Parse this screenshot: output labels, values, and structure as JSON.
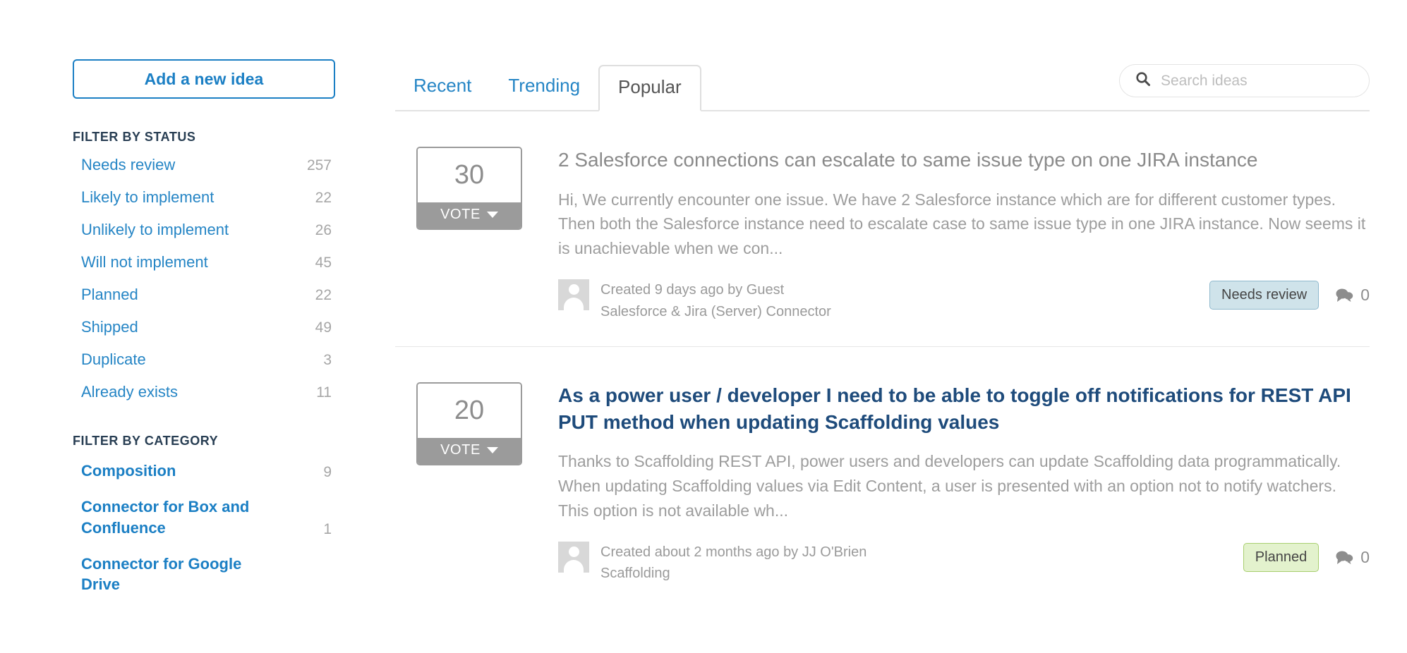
{
  "sidebar": {
    "add_idea_label": "Add a new idea",
    "status_heading": "FILTER BY STATUS",
    "statuses": [
      {
        "label": "Needs review",
        "count": "257"
      },
      {
        "label": "Likely to implement",
        "count": "22"
      },
      {
        "label": "Unlikely to implement",
        "count": "26"
      },
      {
        "label": "Will not implement",
        "count": "45"
      },
      {
        "label": "Planned",
        "count": "22"
      },
      {
        "label": "Shipped",
        "count": "49"
      },
      {
        "label": "Duplicate",
        "count": "3"
      },
      {
        "label": "Already exists",
        "count": "11"
      }
    ],
    "category_heading": "FILTER BY CATEGORY",
    "categories": [
      {
        "label": "Composition",
        "count": "9"
      },
      {
        "label": "Connector for Box and Confluence",
        "count": "1"
      },
      {
        "label": "Connector for Google Drive",
        "count": ""
      }
    ]
  },
  "tabs": [
    {
      "label": "Recent",
      "active": false
    },
    {
      "label": "Trending",
      "active": false
    },
    {
      "label": "Popular",
      "active": true
    }
  ],
  "search": {
    "placeholder": "Search ideas",
    "value": "",
    "icon": "search-icon"
  },
  "ideas": [
    {
      "votes": "30",
      "vote_label": "VOTE",
      "title": "2 Salesforce connections can escalate to same issue type on one JIRA instance",
      "description": "Hi, We currently encounter one issue. We have 2 Salesforce instance which are for different customer types. Then both the Salesforce instance need to escalate case to same issue type in one JIRA instance. Now seems it is unachievable when we con...",
      "created": "Created 9 days ago by Guest",
      "category": "Salesforce & Jira (Server) Connector",
      "status": "Needs review",
      "status_style": "needs-review",
      "comments": "0",
      "title_style": "visited"
    },
    {
      "votes": "20",
      "vote_label": "VOTE",
      "title": "As a power user / developer I need to be able to toggle off notifications for REST API PUT method when updating Scaffolding values",
      "description": "Thanks to Scaffolding REST API, power users and developers can update Scaffolding data programmatically. When updating Scaffolding values via Edit Content, a user is presented with an option not to notify watchers. This option is not available wh...",
      "created": "Created about 2 months ago by JJ O'Brien",
      "category": "Scaffolding",
      "status": "Planned",
      "status_style": "planned",
      "comments": "0",
      "title_style": "unvisited"
    }
  ],
  "colors": {
    "link_blue": "#2585c5",
    "brand_blue": "#1b7fc4",
    "title_navy": "#1e4b7b",
    "muted_gray": "#9a9a9a",
    "needs_review_bg": "#cfe3ea",
    "planned_bg": "#e3f2cd"
  }
}
